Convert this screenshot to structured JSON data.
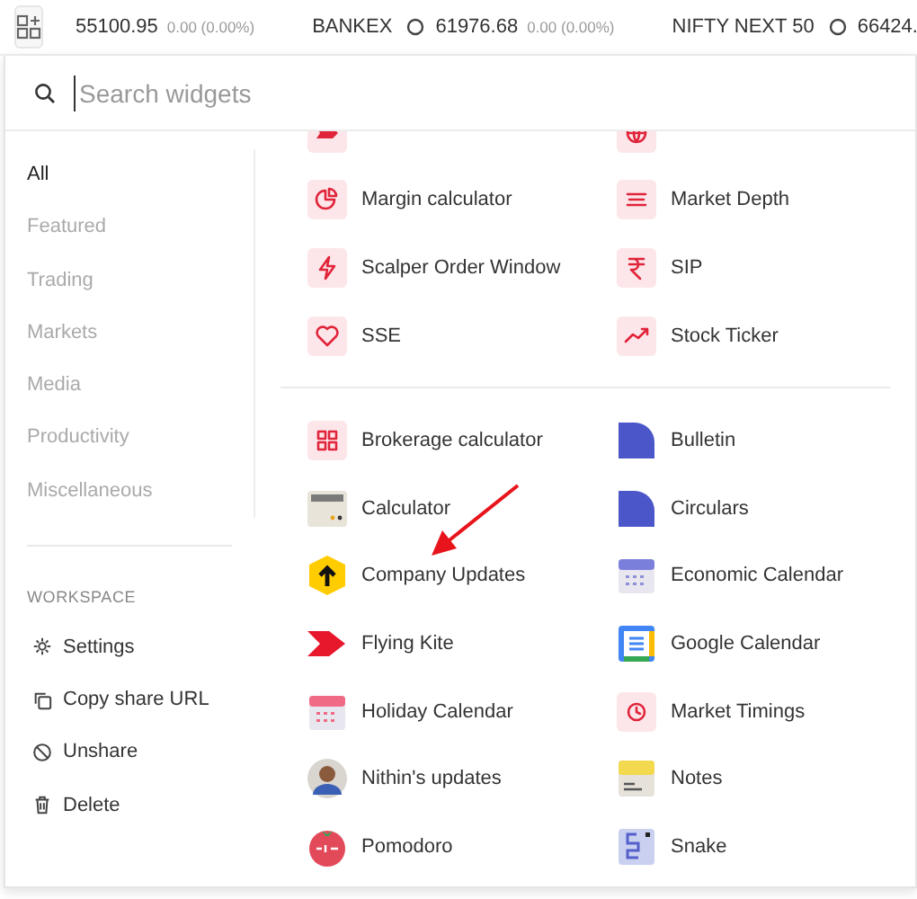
{
  "ticker": [
    {
      "value": "55100.95",
      "change": "0.00 (0.00%)"
    },
    {
      "name": "BANKEX",
      "value": "61976.68",
      "change": "0.00 (0.00%)"
    },
    {
      "name": "NIFTY NEXT 50",
      "value": "66424."
    }
  ],
  "search": {
    "placeholder": "Search widgets"
  },
  "categories": [
    {
      "label": "All",
      "selected": true
    },
    {
      "label": "Featured",
      "selected": false
    },
    {
      "label": "Trading",
      "selected": false
    },
    {
      "label": "Markets",
      "selected": false
    },
    {
      "label": "Media",
      "selected": false
    },
    {
      "label": "Productivity",
      "selected": false
    },
    {
      "label": "Miscellaneous",
      "selected": false
    }
  ],
  "workspace": {
    "heading": "WORKSPACE",
    "items": [
      "Settings",
      "Copy share URL",
      "Unshare",
      "Delete"
    ]
  },
  "sections": [
    {
      "widgets": [
        "Margin calculator",
        "Market Depth",
        "Scalper Order Window",
        "SIP",
        "SSE",
        "Stock Ticker"
      ]
    },
    {
      "widgets": [
        "Brokerage calculator",
        "Bulletin",
        "Calculator",
        "Circulars",
        "Company Updates",
        "Economic Calendar",
        "Flying Kite",
        "Google Calendar",
        "Holiday Calendar",
        "Market Timings",
        "Nithin's updates",
        "Notes",
        "Pomodoro",
        "Snake"
      ]
    }
  ]
}
